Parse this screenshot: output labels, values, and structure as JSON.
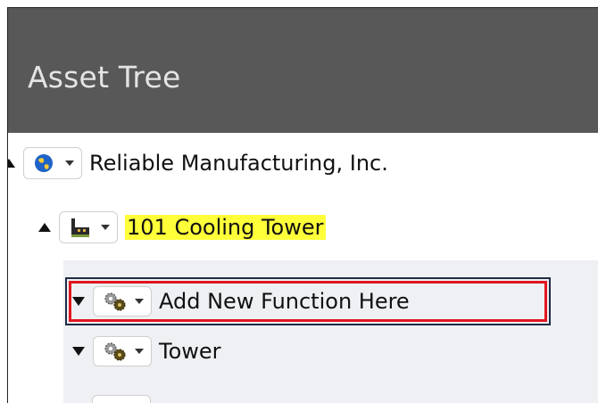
{
  "header": {
    "title": "Asset Tree"
  },
  "tree": {
    "root": {
      "label": "Reliable Manufacturing, Inc.",
      "icon": "globe-icon",
      "expanded": true
    },
    "level1": {
      "label": "101 Cooling Tower",
      "icon": "factory-icon",
      "highlight_color": "#ffff3a",
      "expanded": true
    },
    "children": [
      {
        "label": "Add New Function Here",
        "icon": "gears-icon",
        "selected": true
      },
      {
        "label": "Tower",
        "icon": "gears-icon",
        "selected": false
      }
    ]
  },
  "colors": {
    "header_bg": "#585858",
    "selection_red": "#e0161e",
    "selection_navy": "#1f2c47",
    "child_bg": "#eef0f3"
  }
}
